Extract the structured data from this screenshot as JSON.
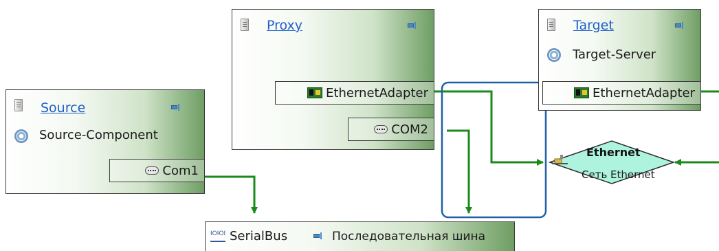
{
  "nodes": {
    "proxy": {
      "title": "Proxy",
      "ports": {
        "ethernet": "EthernetAdapter",
        "com": "COM2"
      }
    },
    "target": {
      "title": "Target",
      "component": "Target-Server",
      "ports": {
        "ethernet": "EthernetAdapter"
      }
    },
    "source": {
      "title": "Source",
      "component": "Source-Component",
      "ports": {
        "com": "Com1"
      }
    }
  },
  "network": {
    "name": "Ethernet",
    "subtitle": "Сеть Ethernet"
  },
  "bus": {
    "name": "SerialBus",
    "subtitle": "Последовательная шина"
  },
  "colors": {
    "link": "#1a8a1a",
    "selection": "#1f5fa6",
    "title_link": "#1f5fc9",
    "node_gradient_end": "#6f9e64",
    "network_fill": "#aef3de"
  },
  "icons": [
    "server-icon",
    "pin-icon",
    "gear-icon",
    "com-port-icon",
    "ethernet-adapter-icon",
    "network-icon",
    "bus-icon"
  ]
}
